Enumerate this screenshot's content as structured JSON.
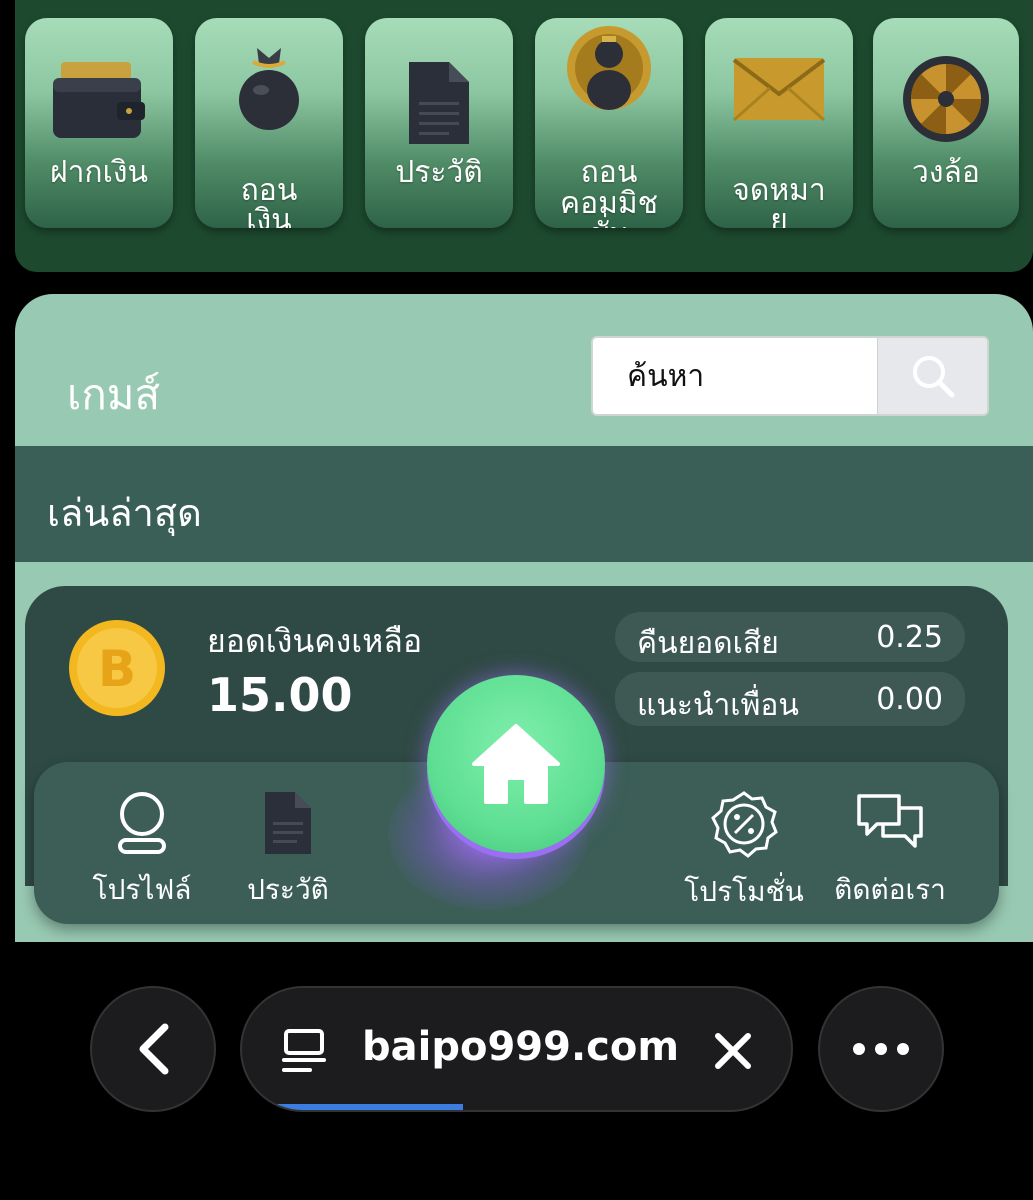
{
  "top_menu": [
    {
      "label": "ฝากเงิน",
      "icon": "wallet-icon"
    },
    {
      "label": "ถอน\nเงิน",
      "icon": "money-bag-icon"
    },
    {
      "label": "ประวัติ",
      "icon": "document-icon"
    },
    {
      "label": "ถอน\nคอมมิช\nชั่น",
      "icon": "commission-icon"
    },
    {
      "label": "จดหมา\nย",
      "icon": "envelope-icon"
    },
    {
      "label": "วงล้อ",
      "icon": "wheel-icon"
    }
  ],
  "games": {
    "title": "เกมส์",
    "search_placeholder": "ค้นหา",
    "recent_title": "เล่นล่าสุด"
  },
  "balance": {
    "label": "ยอดเงินคงเหลือ",
    "value": "15.00",
    "stats": [
      {
        "label": "คืนยอดเสีย",
        "value": "0.25"
      },
      {
        "label": "แนะนำเพื่อน",
        "value": "0.00"
      }
    ]
  },
  "bottom_nav": {
    "profile": "โปรไฟล์",
    "history": "ประวัติ",
    "promotion": "โปรโมชั่น",
    "contact": "ติดต่อเรา"
  },
  "browser": {
    "url": "baipo999.com",
    "load_progress": 0.34
  },
  "colors": {
    "top_panel": "#1d4a2f",
    "games_panel": "#98c9b3",
    "recent_bar": "#3a5f56",
    "card": "#2f4a44",
    "home_button": "#5fdf93",
    "load_bar": "#3b7de0"
  }
}
